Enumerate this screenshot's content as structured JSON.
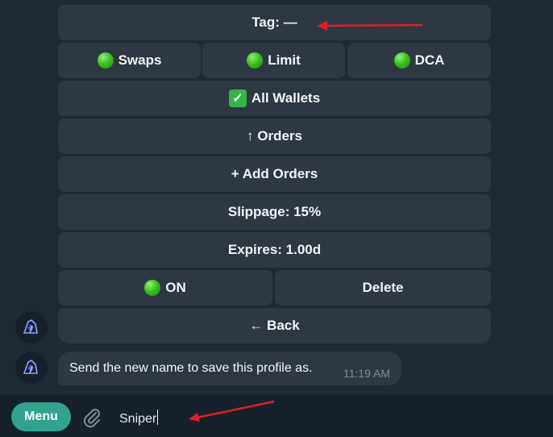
{
  "keyboard": {
    "tag_label": "Tag: —",
    "swaps_label": "Swaps",
    "limit_label": "Limit",
    "dca_label": "DCA",
    "all_wallets_label": "All Wallets",
    "orders_label": "↑ Orders",
    "add_orders_label": "+ Add Orders",
    "slippage_label": "Slippage: 15%",
    "expires_label": "Expires: 1.00d",
    "on_label": "ON",
    "delete_label": "Delete",
    "back_label": "← Back"
  },
  "message": {
    "text": "Send the new name to save this profile as.",
    "time": "11:19 AM"
  },
  "composer": {
    "menu_label": "Menu",
    "input_value": "Sniper"
  },
  "colors": {
    "background": "#202a35",
    "button_bg": "#2e3843",
    "menu_button": "#30a28d",
    "annotation_arrow": "#e02020",
    "status_dot": "#3cc21e"
  },
  "icons": {
    "status": "green-circle-icon",
    "check": "check-mark-icon",
    "attach": "paperclip-icon",
    "avatar": "bot-avatar-icon"
  }
}
